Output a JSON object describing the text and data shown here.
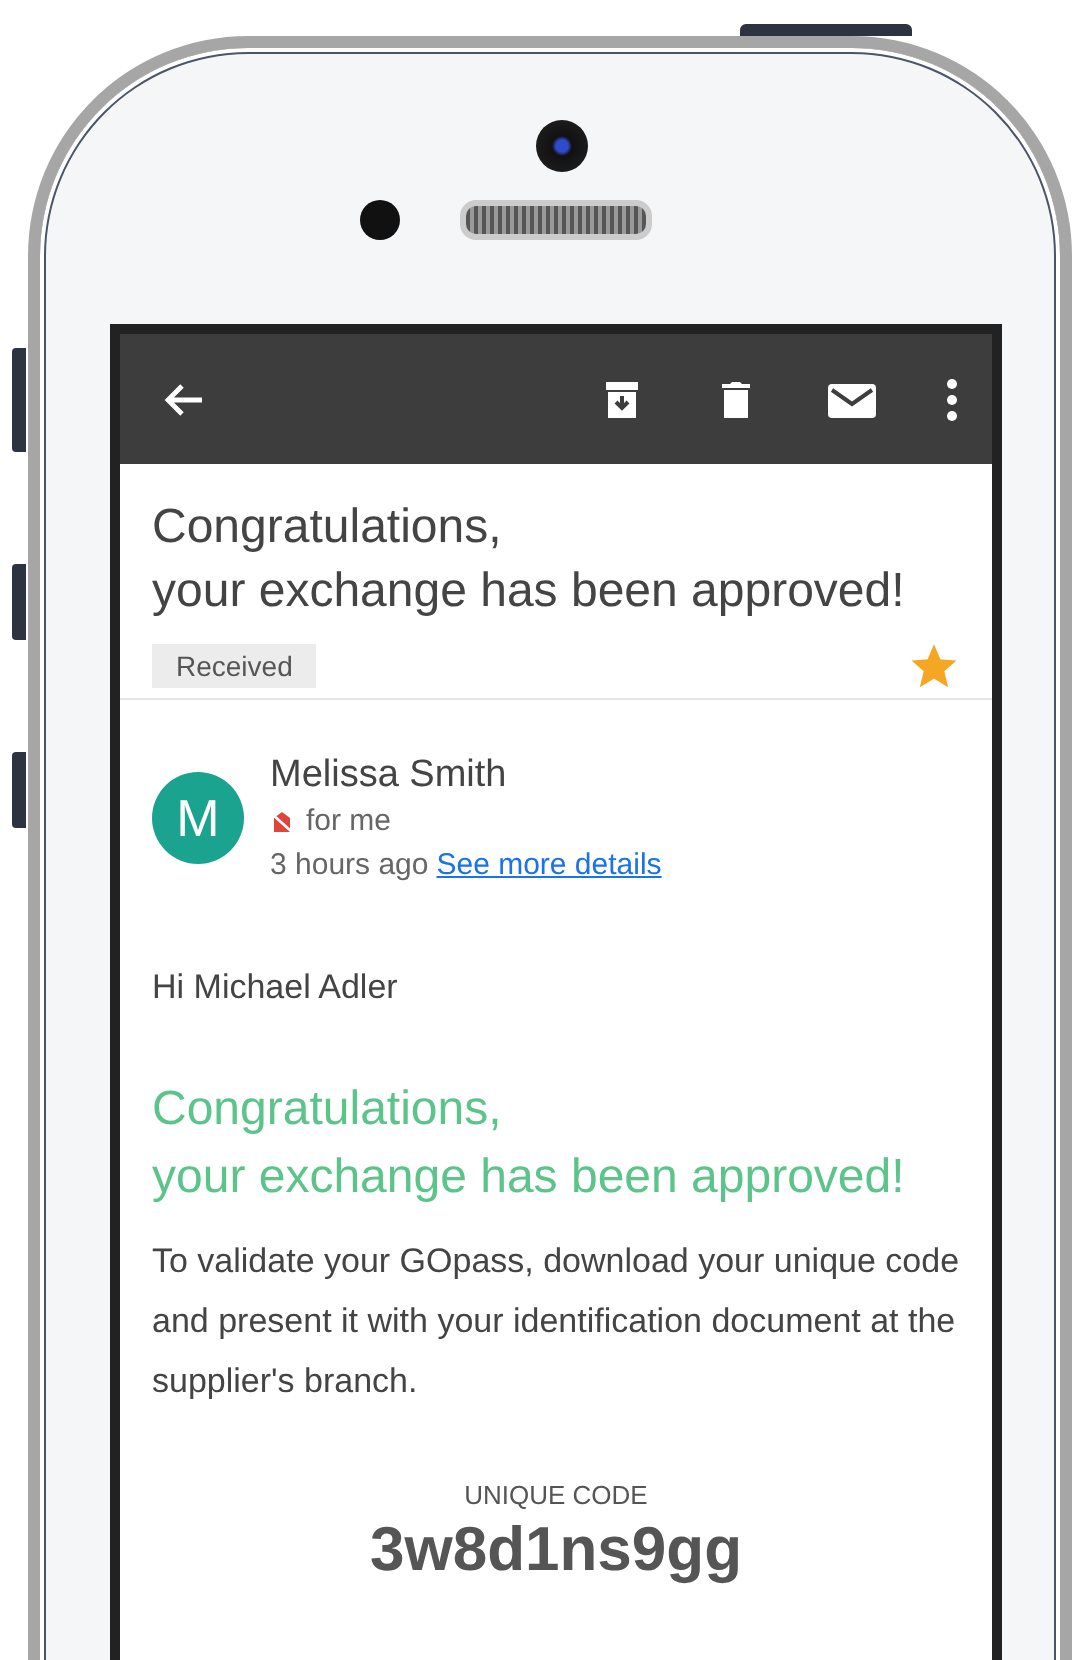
{
  "toolbar": {
    "actions": [
      {
        "kind": "archive"
      },
      {
        "kind": "delete"
      },
      {
        "kind": "mail"
      },
      {
        "kind": "more"
      }
    ]
  },
  "subject": {
    "lines": [
      "Congratulations,",
      "your exchange has been approved!"
    ],
    "label": "Received",
    "starred": true
  },
  "sender": {
    "avatar_letter": "M",
    "name": "Melissa Smith",
    "recipient": "for me",
    "time": "3 hours ago",
    "details_link": "See more details"
  },
  "message": {
    "greeting": "Hi Michael Adler",
    "heading_lines": [
      "Congratulations,",
      "your exchange has been approved!"
    ],
    "body": "To validate your GOpass, download your unique code and present it with your identification document at the supplier's branch.",
    "code_label": "UNIQUE CODE",
    "code": "3w8d1ns9gg"
  }
}
